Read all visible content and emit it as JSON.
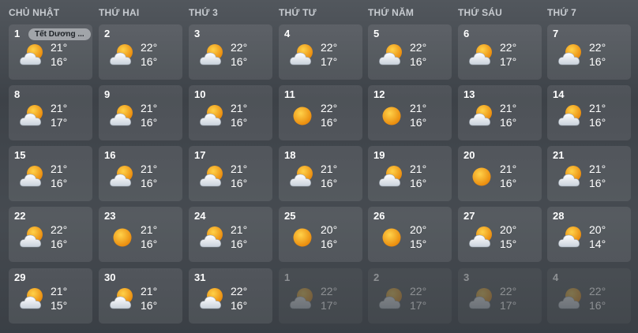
{
  "weekdays": [
    "CHỦ NHẬT",
    "THỨ HAI",
    "THỨ 3",
    "THỨ TƯ",
    "THỨ NĂM",
    "THỨ SÁU",
    "THỨ 7"
  ],
  "weeks": [
    [
      {
        "day": "1",
        "high": "21°",
        "low": "16°",
        "icon": "partly-cloudy-icon",
        "current_month": true,
        "event": "Tết Dương ..."
      },
      {
        "day": "2",
        "high": "22°",
        "low": "16°",
        "icon": "partly-cloudy-icon",
        "current_month": true
      },
      {
        "day": "3",
        "high": "22°",
        "low": "16°",
        "icon": "partly-cloudy-icon",
        "current_month": true
      },
      {
        "day": "4",
        "high": "22°",
        "low": "17°",
        "icon": "partly-cloudy-icon",
        "current_month": true
      },
      {
        "day": "5",
        "high": "22°",
        "low": "16°",
        "icon": "partly-cloudy-icon",
        "current_month": true
      },
      {
        "day": "6",
        "high": "22°",
        "low": "17°",
        "icon": "partly-cloudy-icon",
        "current_month": true
      },
      {
        "day": "7",
        "high": "22°",
        "low": "16°",
        "icon": "partly-cloudy-icon",
        "current_month": true
      }
    ],
    [
      {
        "day": "8",
        "high": "21°",
        "low": "17°",
        "icon": "partly-cloudy-icon",
        "current_month": true
      },
      {
        "day": "9",
        "high": "21°",
        "low": "16°",
        "icon": "partly-cloudy-icon",
        "current_month": true
      },
      {
        "day": "10",
        "high": "21°",
        "low": "16°",
        "icon": "partly-cloudy-icon",
        "current_month": true
      },
      {
        "day": "11",
        "high": "22°",
        "low": "16°",
        "icon": "sunny-icon",
        "current_month": true
      },
      {
        "day": "12",
        "high": "21°",
        "low": "16°",
        "icon": "sunny-icon",
        "current_month": true
      },
      {
        "day": "13",
        "high": "21°",
        "low": "16°",
        "icon": "partly-cloudy-icon",
        "current_month": true
      },
      {
        "day": "14",
        "high": "21°",
        "low": "16°",
        "icon": "partly-cloudy-icon",
        "current_month": true
      }
    ],
    [
      {
        "day": "15",
        "high": "21°",
        "low": "16°",
        "icon": "partly-cloudy-icon",
        "current_month": true
      },
      {
        "day": "16",
        "high": "21°",
        "low": "16°",
        "icon": "partly-cloudy-icon",
        "current_month": true
      },
      {
        "day": "17",
        "high": "21°",
        "low": "16°",
        "icon": "partly-cloudy-icon",
        "current_month": true
      },
      {
        "day": "18",
        "high": "21°",
        "low": "16°",
        "icon": "partly-cloudy-icon",
        "current_month": true
      },
      {
        "day": "19",
        "high": "21°",
        "low": "16°",
        "icon": "partly-cloudy-icon",
        "current_month": true
      },
      {
        "day": "20",
        "high": "21°",
        "low": "16°",
        "icon": "sunny-icon",
        "current_month": true
      },
      {
        "day": "21",
        "high": "21°",
        "low": "16°",
        "icon": "partly-cloudy-icon",
        "current_month": true
      }
    ],
    [
      {
        "day": "22",
        "high": "22°",
        "low": "16°",
        "icon": "partly-cloudy-icon",
        "current_month": true
      },
      {
        "day": "23",
        "high": "21°",
        "low": "16°",
        "icon": "sunny-icon",
        "current_month": true
      },
      {
        "day": "24",
        "high": "21°",
        "low": "16°",
        "icon": "partly-cloudy-icon",
        "current_month": true
      },
      {
        "day": "25",
        "high": "20°",
        "low": "16°",
        "icon": "sunny-icon",
        "current_month": true
      },
      {
        "day": "26",
        "high": "20°",
        "low": "15°",
        "icon": "sunny-icon",
        "current_month": true
      },
      {
        "day": "27",
        "high": "20°",
        "low": "15°",
        "icon": "partly-cloudy-icon",
        "current_month": true
      },
      {
        "day": "28",
        "high": "20°",
        "low": "14°",
        "icon": "partly-cloudy-icon",
        "current_month": true
      }
    ],
    [
      {
        "day": "29",
        "high": "21°",
        "low": "15°",
        "icon": "partly-cloudy-icon",
        "current_month": true
      },
      {
        "day": "30",
        "high": "21°",
        "low": "16°",
        "icon": "partly-cloudy-icon",
        "current_month": true
      },
      {
        "day": "31",
        "high": "22°",
        "low": "16°",
        "icon": "partly-cloudy-icon",
        "current_month": true
      },
      {
        "day": "1",
        "high": "22°",
        "low": "17°",
        "icon": "partly-cloudy-icon",
        "current_month": false
      },
      {
        "day": "2",
        "high": "22°",
        "low": "17°",
        "icon": "partly-cloudy-icon",
        "current_month": false
      },
      {
        "day": "3",
        "high": "22°",
        "low": "17°",
        "icon": "partly-cloudy-icon",
        "current_month": false
      },
      {
        "day": "4",
        "high": "22°",
        "low": "16°",
        "icon": "partly-cloudy-icon",
        "current_month": false
      }
    ]
  ],
  "colors": {
    "sun": "#f7b21c",
    "sun_edge": "#e98a0c",
    "cloud": "#eef2f7",
    "weekday_text": "#c7cbd0"
  }
}
